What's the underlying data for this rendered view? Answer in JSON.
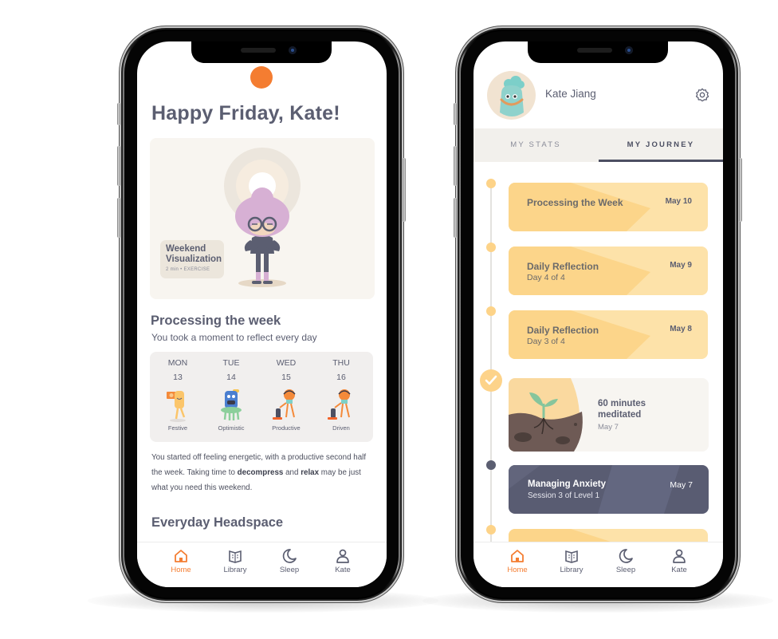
{
  "home_screen": {
    "greeting": "Happy Friday, Kate!",
    "featured": {
      "title_line1": "Weekend",
      "title_line2": "Visualization",
      "meta": "2 min  •  EXERCISE"
    },
    "processing": {
      "title": "Processing the week",
      "subtitle": "You took a moment to reflect every day",
      "days": [
        {
          "day": "MON",
          "date": "13",
          "mood": "Festive"
        },
        {
          "day": "TUE",
          "date": "14",
          "mood": "Optimistic"
        },
        {
          "day": "WED",
          "date": "15",
          "mood": "Productive"
        },
        {
          "day": "THU",
          "date": "16",
          "mood": "Driven"
        }
      ],
      "summary_part1": "You started off feeling energetic, with a  productive second half the week. Taking time to ",
      "summary_bold1": "decompress",
      "summary_part2": " and ",
      "summary_bold2": "relax",
      "summary_part3": " may be just what you need this weekend."
    },
    "section2_title": "Everyday Headspace"
  },
  "profile_screen": {
    "user_name": "Kate Jiang",
    "tabs": [
      {
        "label": "MY STATS",
        "active": false
      },
      {
        "label": "MY JOURNEY",
        "active": true
      }
    ],
    "journey": [
      {
        "title": "Processing the Week",
        "subtitle": "",
        "date": "May 10"
      },
      {
        "title": "Daily Reflection",
        "subtitle": "Day 4 of 4",
        "date": "May 9"
      },
      {
        "title": "Daily Reflection",
        "subtitle": "Day 3 of 4",
        "date": "May 8"
      }
    ],
    "milestone": {
      "line1": "60 minutes",
      "line2": "meditated",
      "date": "May 7"
    },
    "course": {
      "title": "Managing Anxiety",
      "subtitle": "Session 3 of Level 1",
      "date": "May 7"
    }
  },
  "tabbar": {
    "items": [
      {
        "label": "Home",
        "icon": "home-icon",
        "active": true
      },
      {
        "label": "Library",
        "icon": "book-icon",
        "active": false
      },
      {
        "label": "Sleep",
        "icon": "moon-icon",
        "active": false
      },
      {
        "label": "Kate",
        "icon": "person-icon",
        "active": false
      }
    ]
  },
  "colors": {
    "accent_orange": "#f47d31",
    "text_slate": "#5b5e71",
    "journey_yellow": "#fde2a9",
    "dark_card": "#595c72"
  }
}
